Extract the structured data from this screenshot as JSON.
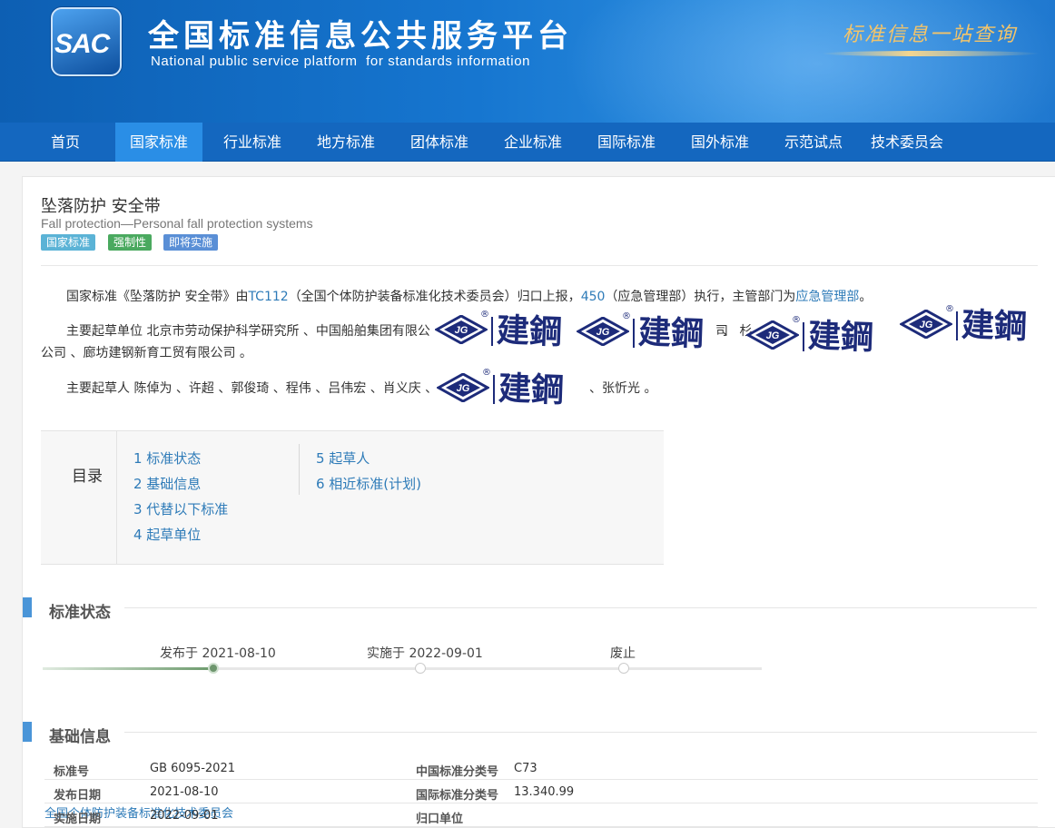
{
  "header": {
    "logo_text": "SAC",
    "title": "全国标准信息公共服务平台",
    "subtitle": "National public service platform  for standards information",
    "slogan": "标准信息一站查询"
  },
  "nav": [
    "首页",
    "国家标准",
    "行业标准",
    "地方标准",
    "团体标准",
    "企业标准",
    "国际标准",
    "国外标准",
    "示范试点",
    "技术委员会"
  ],
  "nav_active": "国家标准",
  "standard": {
    "title_cn": "坠落防护 安全带",
    "title_en": "Fall protection—Personal fall protection systems",
    "badges": [
      "国家标准",
      "强制性",
      "即将实施"
    ],
    "badge_colors": [
      "#5bb3d6",
      "#4aa95f",
      "#5a8fd6"
    ]
  },
  "intro": {
    "p1_a": "国家标准《坠落防护 安全带》由",
    "p1_link1": "TC112",
    "p1_b": "（全国个体防护装备标准化技术委员会）归口上报，",
    "p1_link2": "450",
    "p1_c": "（应急管理部）执行，主管部门为",
    "p1_link3": "应急管理部",
    "p1_d": "。",
    "p2_line1": "主要起草单位 北京市劳动保护科学研究所 、中国船舶集团有限公",
    "p2_mid1": "司",
    "p2_mid2": "、 杉",
    "p2_line2": "公司 、廊坊建钢新育工贸有限公司 。",
    "p3_a": "主要起草人 陈倬为 、许超 、郭俊琦 、程伟 、吕伟宏 、肖义庆 、",
    "p3_b": "、张忻光 。"
  },
  "watermark": {
    "text": "建鋼",
    "reg": "®"
  },
  "toc": {
    "title": "目录",
    "items": [
      "1  标准状态",
      "2  基础信息",
      "3  代替以下标准",
      "4  起草单位",
      "5  起草人",
      "6  相近标准(计划)"
    ]
  },
  "sections": {
    "status": "标准状态",
    "basic": "基础信息"
  },
  "timeline": {
    "published": "发布于 2021-08-10",
    "implemented": "实施于 2022-09-01",
    "abolished": "废止"
  },
  "basic_info": [
    {
      "l1": "标准号",
      "v1": "GB 6095-2021",
      "l2": "中国标准分类号",
      "v2": "C73"
    },
    {
      "l1": "发布日期",
      "v1": "2021-08-10",
      "l2": "国际标准分类号",
      "v2": "13.340.99"
    },
    {
      "l1": "实施日期",
      "v1": "2022-09-01",
      "l2": "归口单位",
      "v2": "全国个体防护装备标准化技术委员会"
    }
  ]
}
